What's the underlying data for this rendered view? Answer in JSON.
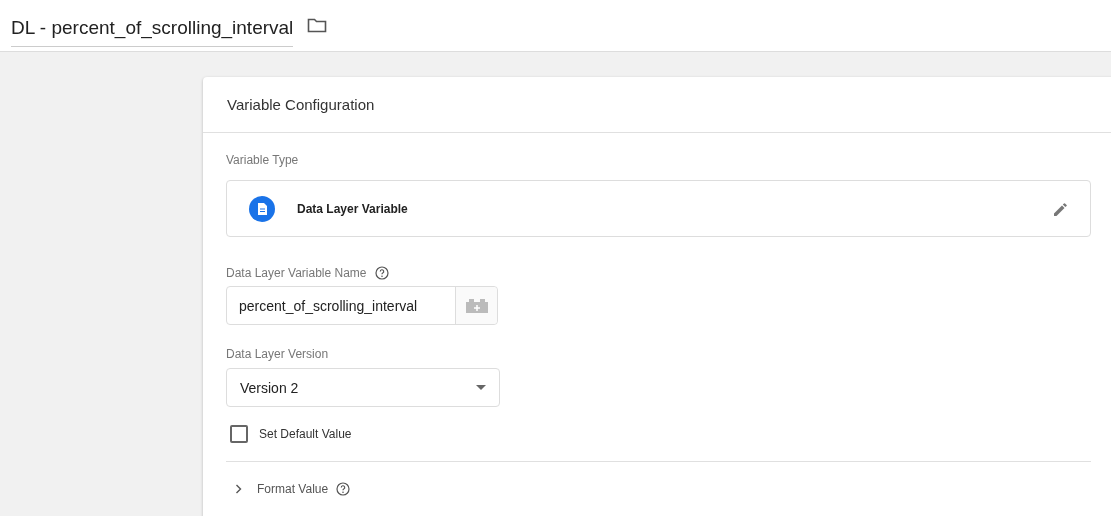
{
  "header": {
    "title": "DL - percent_of_scrolling_interval"
  },
  "card": {
    "title": "Variable Configuration",
    "variable_type": {
      "label": "Variable Type",
      "name": "Data Layer Variable"
    },
    "name_field": {
      "label": "Data Layer Variable Name",
      "value": "percent_of_scrolling_interval"
    },
    "version_field": {
      "label": "Data Layer Version",
      "value": "Version 2"
    },
    "default_checkbox": {
      "label": "Set Default Value",
      "checked": false
    },
    "format_section": {
      "label": "Format Value",
      "expanded": false
    }
  }
}
